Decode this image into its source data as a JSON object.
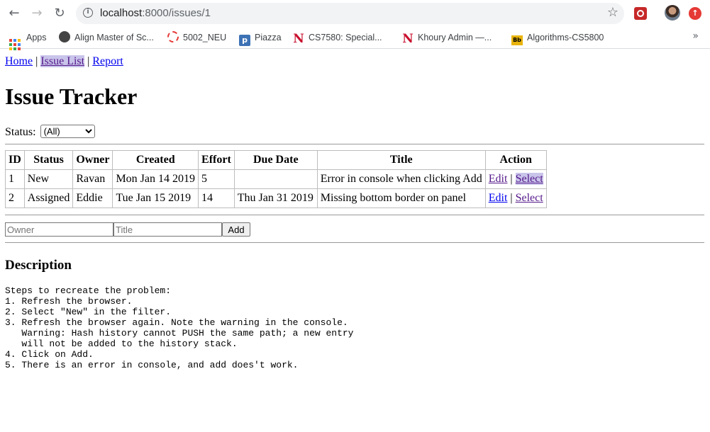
{
  "browser": {
    "url_host": "localhost",
    "url_rest": ":8000/issues/1",
    "bookmarks": [
      {
        "label": "Apps",
        "icon": "apps-grid-icon"
      },
      {
        "label": "Align Master of Sc...",
        "icon": "globe-icon"
      },
      {
        "label": "5002_NEU",
        "icon": "ring-icon"
      },
      {
        "label": "Piazza",
        "icon": "piazza-icon"
      },
      {
        "label": "CS7580: Special...",
        "icon": "northeastern-icon"
      },
      {
        "label": "Khoury Admin —...",
        "icon": "northeastern-icon"
      },
      {
        "label": "Algorithms-CS5800",
        "icon": "blackboard-icon"
      }
    ],
    "more_glyph": "»"
  },
  "nav": {
    "home": "Home",
    "sep1": "|",
    "issue_list": "Issue List",
    "sep2": "|",
    "report": "Report"
  },
  "page": {
    "title": "Issue Tracker"
  },
  "filter": {
    "label": "Status:",
    "selected": "(All)"
  },
  "table": {
    "headers": [
      "ID",
      "Status",
      "Owner",
      "Created",
      "Effort",
      "Due Date",
      "Title",
      "Action"
    ],
    "rows": [
      {
        "id": "1",
        "status": "New",
        "owner": "Ravan",
        "created": "Mon Jan 14 2019",
        "effort": "5",
        "due": "",
        "title": "Error in console when clicking Add",
        "edit": "Edit",
        "sep": "|",
        "select": "Select"
      },
      {
        "id": "2",
        "status": "Assigned",
        "owner": "Eddie",
        "created": "Tue Jan 15 2019",
        "effort": "14",
        "due": "Thu Jan 31 2019",
        "title": "Missing bottom border on panel",
        "edit": "Edit",
        "sep": "|",
        "select": "Select"
      }
    ]
  },
  "add_form": {
    "owner_placeholder": "Owner",
    "title_placeholder": "Title",
    "add_label": "Add"
  },
  "description": {
    "heading": "Description",
    "body": "Steps to recreate the problem:\n1. Refresh the browser.\n2. Select \"New\" in the filter.\n3. Refresh the browser again. Note the warning in the console.\n   Warning: Hash history cannot PUSH the same path; a new entry\n   will not be added to the history stack.\n4. Click on Add.\n5. There is an error in console, and add does't work."
  }
}
